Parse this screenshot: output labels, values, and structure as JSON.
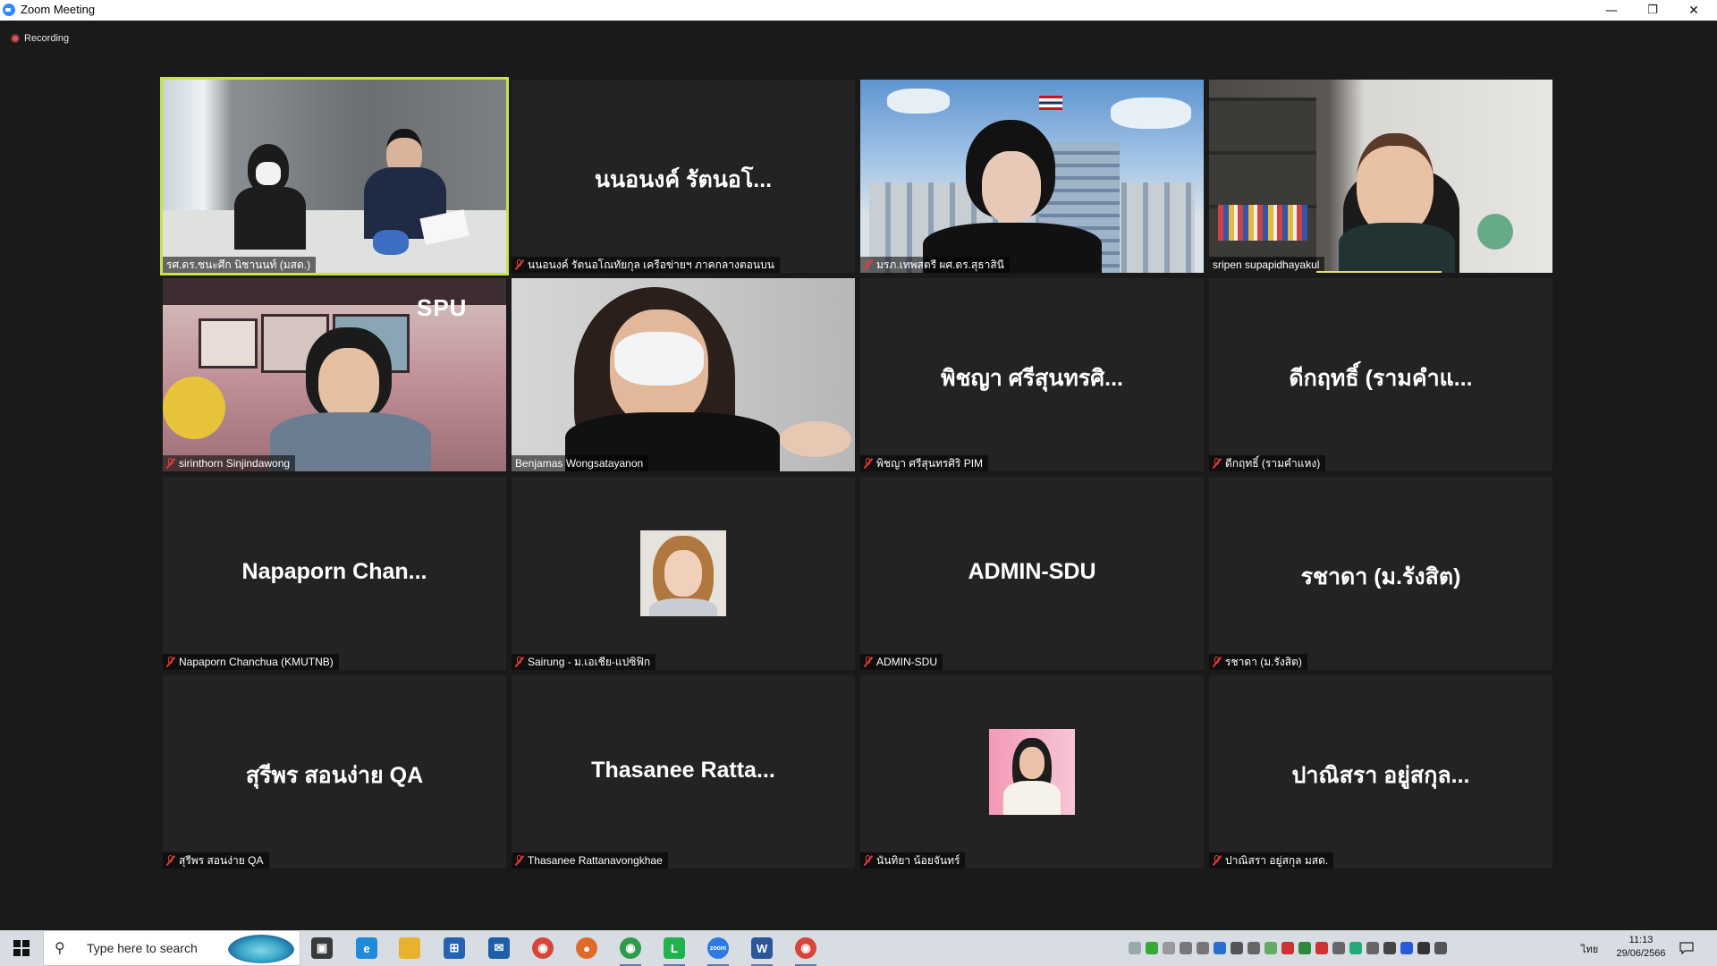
{
  "window": {
    "title": "Zoom Meeting",
    "minimize_symbol": "—",
    "restore_symbol": "❐",
    "close_symbol": "✕"
  },
  "recording": {
    "label": "Recording",
    "color": "#e0504a"
  },
  "accent": {
    "active_speaker_border": "#c7e24b",
    "mute_icon": "#e8393a"
  },
  "participants": [
    {
      "label": "รศ.ดร.ชนะศึก นิชานนท์ (มสด.)",
      "video": "office-two",
      "muted": false,
      "active": true
    },
    {
      "display_name": "นนอนงค์  รัตนอโ...",
      "label": "นนอนงค์ รัตนอโณทัยกุล เครือข่ายฯ ภาคกลางตอนบน",
      "video": "none",
      "muted": true
    },
    {
      "label": "มรภ.เทพสตรี ผศ.ดร.สุธาสินี",
      "video": "building",
      "muted": true
    },
    {
      "label": "sripen supapidhayakul",
      "video": "bookshelf",
      "muted": false,
      "speaking": true
    },
    {
      "label": "sirinthorn Sinjindawong",
      "video": "spu",
      "muted": true,
      "logo": "SPU"
    },
    {
      "label": "Benjamas Wongsatayanon",
      "video": "mask",
      "muted": false
    },
    {
      "display_name": "พิชญา ศรีสุนทรศิ...",
      "label": "พิชญา ศรีสุนทรศิริ PIM",
      "video": "none",
      "muted": true
    },
    {
      "display_name": "ดีกฤทธิ์ (รามคำแ...",
      "label": "ดีกฤทธิ์ (รามคำแหง)",
      "video": "none",
      "muted": true
    },
    {
      "display_name": "Napaporn  Chan...",
      "label": "Napaporn Chanchua (KMUTNB)",
      "video": "none",
      "muted": true
    },
    {
      "label": "Sairung - ม.เอเชีย-แปซิฟิก",
      "video": "avatar-woman",
      "muted": true
    },
    {
      "display_name": "ADMIN-SDU",
      "label": "ADMIN-SDU",
      "video": "none",
      "muted": true
    },
    {
      "display_name": "รชาดา (ม.รังสิต)",
      "label": "รชาดา (ม.รังสิต)",
      "video": "none",
      "muted": true
    },
    {
      "display_name": "สุรีพร สอนง่าย QA",
      "label": "สุรีพร สอนง่าย QA",
      "video": "none",
      "muted": true
    },
    {
      "display_name": "Thasanee  Ratta...",
      "label": "Thasanee Rattanavongkhae",
      "video": "none",
      "muted": true
    },
    {
      "label": "นันทิยา น้อยจันทร์",
      "video": "avatar-pink",
      "muted": true
    },
    {
      "display_name": "ปาณิสรา อยู่สกุล...",
      "label": "ปาณิสรา อยู่สกุล  มสด.",
      "video": "none",
      "muted": true
    }
  ],
  "taskbar": {
    "search_placeholder": "Type here to search",
    "start_icon": "windows-logo-icon",
    "apps": [
      {
        "name": "task-view",
        "color": "#3a3a3a",
        "glyph": "▣",
        "running": false
      },
      {
        "name": "edge",
        "color": "#1f8ad8",
        "glyph": "e",
        "running": false
      },
      {
        "name": "file-explorer",
        "color": "#e8b22b",
        "glyph": "",
        "running": false
      },
      {
        "name": "store",
        "color": "#2563b0",
        "glyph": "⊞",
        "running": false
      },
      {
        "name": "mail",
        "color": "#1e5fa8",
        "glyph": "✉",
        "running": false
      },
      {
        "name": "chrome",
        "color": "#d8453a",
        "glyph": "◉",
        "running": false
      },
      {
        "name": "firefox",
        "color": "#e06a2a",
        "glyph": "●",
        "running": false
      },
      {
        "name": "chrome-profile",
        "color": "#2e9a4a",
        "glyph": "◉",
        "running": true
      },
      {
        "name": "line",
        "color": "#22b14c",
        "glyph": "L",
        "running": true
      },
      {
        "name": "zoom",
        "color": "#2d7be0",
        "glyph": "zoom",
        "running": true
      },
      {
        "name": "word",
        "color": "#2b579a",
        "glyph": "W",
        "running": true
      },
      {
        "name": "chrome-2",
        "color": "#d8453a",
        "glyph": "◉",
        "running": true
      }
    ],
    "tray_colors": [
      "#9aa",
      "#3a3",
      "#999",
      "#777",
      "#777",
      "#2a6fd0",
      "#555",
      "#666",
      "#6a6",
      "#c33",
      "#2a8a3a",
      "#c33",
      "#666",
      "#2a7",
      "#666",
      "#444",
      "#2a5bd7",
      "#333",
      "#555"
    ],
    "language": "ไทย",
    "time": "11:13",
    "date": "29/06/2566"
  }
}
